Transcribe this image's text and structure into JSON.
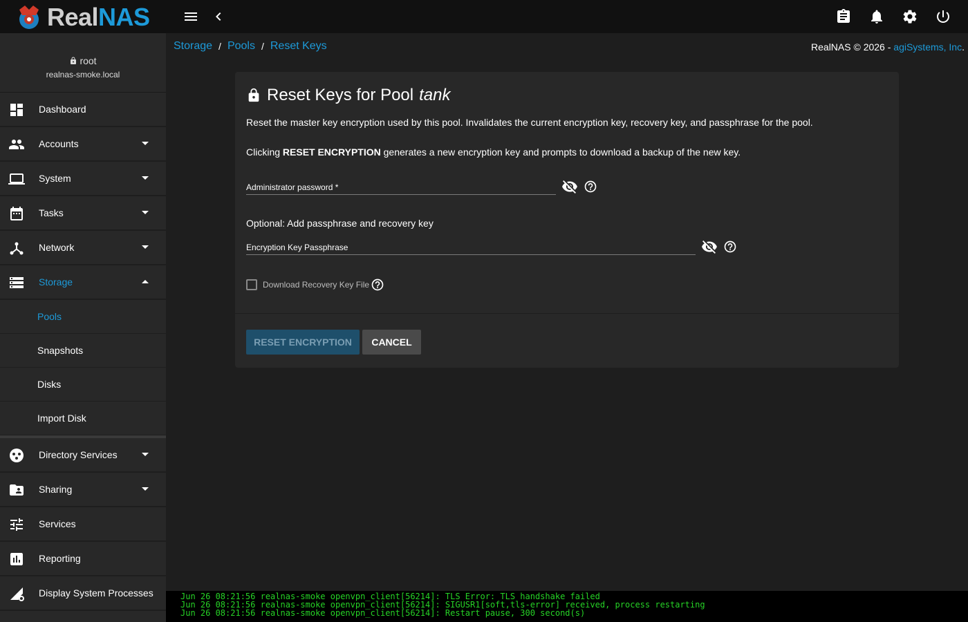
{
  "brand": {
    "part1": "Real",
    "part2": "NAS"
  },
  "topbar": {
    "menu_icon": "menu-icon",
    "back_icon": "chevron-left-icon",
    "right_icons": [
      "clipboard-icon",
      "bell-icon",
      "gear-icon",
      "power-icon"
    ]
  },
  "user": {
    "name": "root",
    "host": "realnas-smoke.local"
  },
  "sidebar": {
    "items": [
      {
        "label": "Dashboard",
        "icon": "dashboard-icon"
      },
      {
        "label": "Accounts",
        "icon": "people-icon"
      },
      {
        "label": "System",
        "icon": "laptop-icon"
      },
      {
        "label": "Tasks",
        "icon": "calendar-icon"
      },
      {
        "label": "Network",
        "icon": "network-icon"
      },
      {
        "label": "Storage",
        "icon": "storage-icon"
      }
    ],
    "storage_sub": [
      "Pools",
      "Snapshots",
      "Disks",
      "Import Disk"
    ],
    "items_after": [
      {
        "label": "Directory Services",
        "icon": "directory-services-icon"
      },
      {
        "label": "Sharing",
        "icon": "folder-shared-icon"
      },
      {
        "label": "Services",
        "icon": "tune-icon"
      },
      {
        "label": "Reporting",
        "icon": "reporting-icon"
      },
      {
        "label": "Display System Processes",
        "icon": "processes-icon"
      }
    ]
  },
  "breadcrumb": {
    "items": [
      "Storage",
      "Pools",
      "Reset Keys"
    ],
    "separator": "/"
  },
  "footer": {
    "copyright": "RealNAS © 2026 - ",
    "company": "agiSystems, Inc",
    "period": "."
  },
  "card": {
    "title_prefix": "Reset Keys for Pool",
    "pool_name": "tank",
    "description": "Reset the master key encryption used by this pool. Invalidates the current encryption key, recovery key, and passphrase for the pool.",
    "click_prefix": "Clicking ",
    "click_bold": "RESET ENCRYPTION",
    "click_suffix": " generates a new encryption key and prompts to download a backup of the new key.",
    "admin_password": {
      "placeholder": "Administrator password *",
      "value": ""
    },
    "optional_label": "Optional: Add passphrase and recovery key",
    "passphrase": {
      "placeholder": "Encryption Key Passphrase",
      "value": ""
    },
    "download_checkbox": {
      "label": "Download Recovery Key File",
      "checked": false
    },
    "buttons": {
      "reset": "RESET ENCRYPTION",
      "cancel": "CANCEL"
    }
  },
  "console": [
    "Jun 26 08:21:56 realnas-smoke openvpn_client[56214]: TLS Error: TLS handshake failed",
    "Jun 26 08:21:56 realnas-smoke openvpn_client[56214]: SIGUSR1[soft,tls-error] received, process restarting",
    "Jun 26 08:21:56 realnas-smoke openvpn_client[56214]: Restart pause, 300 second(s)"
  ],
  "colors": {
    "accent": "#1d9ad9",
    "console_text": "#26d326"
  }
}
